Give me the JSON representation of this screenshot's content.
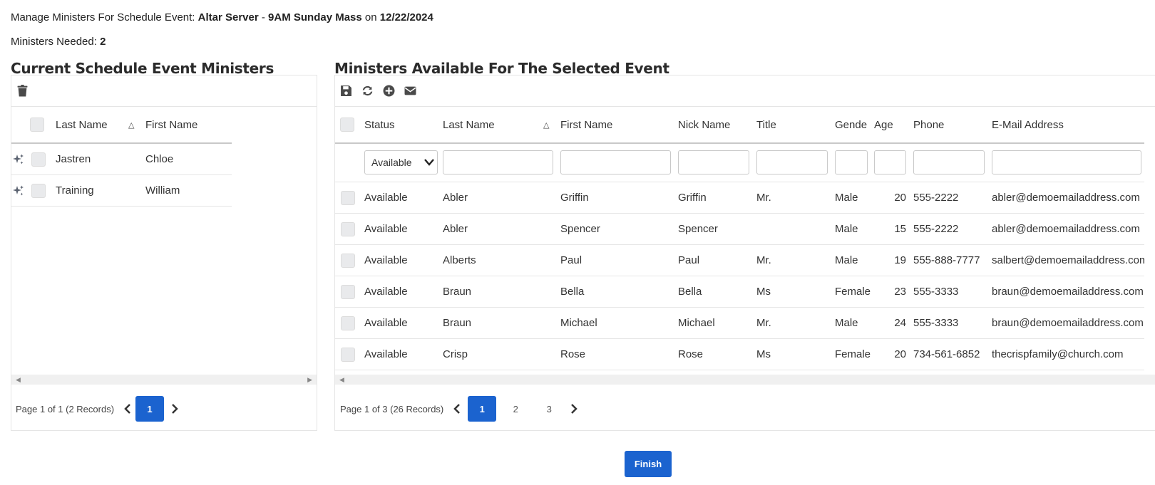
{
  "header": {
    "prefix": "Manage Ministers For Schedule Event: ",
    "ministry": "Altar Server",
    "sep": " - ",
    "event": "9AM Sunday Mass",
    "on": " on ",
    "date": "12/22/2024",
    "needed_label": "Ministers Needed: ",
    "needed_value": "2"
  },
  "left": {
    "title": "Current Schedule Event Ministers",
    "columns": {
      "last": "Last Name",
      "first": "First Name"
    },
    "rows": [
      {
        "last": "Jastren",
        "first": "Chloe"
      },
      {
        "last": "Training",
        "first": "William"
      }
    ],
    "pager": {
      "summary": "Page 1 of 1 (2 Records)",
      "pages": [
        "1"
      ]
    }
  },
  "right": {
    "title": "Ministers Available For The Selected Event",
    "columns": {
      "status": "Status",
      "last": "Last Name",
      "first": "First Name",
      "nick": "Nick Name",
      "title": "Title",
      "gender": "Gende",
      "age": "Age",
      "phone": "Phone",
      "email": "E-Mail Address"
    },
    "status_filter": "Available",
    "rows": [
      {
        "status": "Available",
        "last": "Abler",
        "first": "Griffin",
        "nick": "Griffin",
        "title": "Mr.",
        "gender": "Male",
        "age": "20",
        "phone": "555-2222",
        "email": "abler@demoemailaddress.com"
      },
      {
        "status": "Available",
        "last": "Abler",
        "first": "Spencer",
        "nick": "Spencer",
        "title": "",
        "gender": "Male",
        "age": "15",
        "phone": "555-2222",
        "email": "abler@demoemailaddress.com"
      },
      {
        "status": "Available",
        "last": "Alberts",
        "first": "Paul",
        "nick": "Paul",
        "title": "Mr.",
        "gender": "Male",
        "age": "19",
        "phone": "555-888-7777",
        "email": "salbert@demoemailaddress.com"
      },
      {
        "status": "Available",
        "last": "Braun",
        "first": "Bella",
        "nick": "Bella",
        "title": "Ms",
        "gender": "Female",
        "age": "23",
        "phone": "555-3333",
        "email": "braun@demoemailaddress.com"
      },
      {
        "status": "Available",
        "last": "Braun",
        "first": "Michael",
        "nick": "Michael",
        "title": "Mr.",
        "gender": "Male",
        "age": "24",
        "phone": "555-3333",
        "email": "braun@demoemailaddress.com"
      },
      {
        "status": "Available",
        "last": "Crisp",
        "first": "Rose",
        "nick": "Rose",
        "title": "Ms",
        "gender": "Female",
        "age": "20",
        "phone": "734-561-6852",
        "email": "thecrispfamily@church.com"
      }
    ],
    "pager": {
      "summary": "Page 1 of 3 (26 Records)",
      "pages": [
        "1",
        "2",
        "3"
      ]
    }
  },
  "finish_label": "Finish",
  "colors": {
    "accent": "#1b63cf",
    "link": "#2a62b8"
  }
}
